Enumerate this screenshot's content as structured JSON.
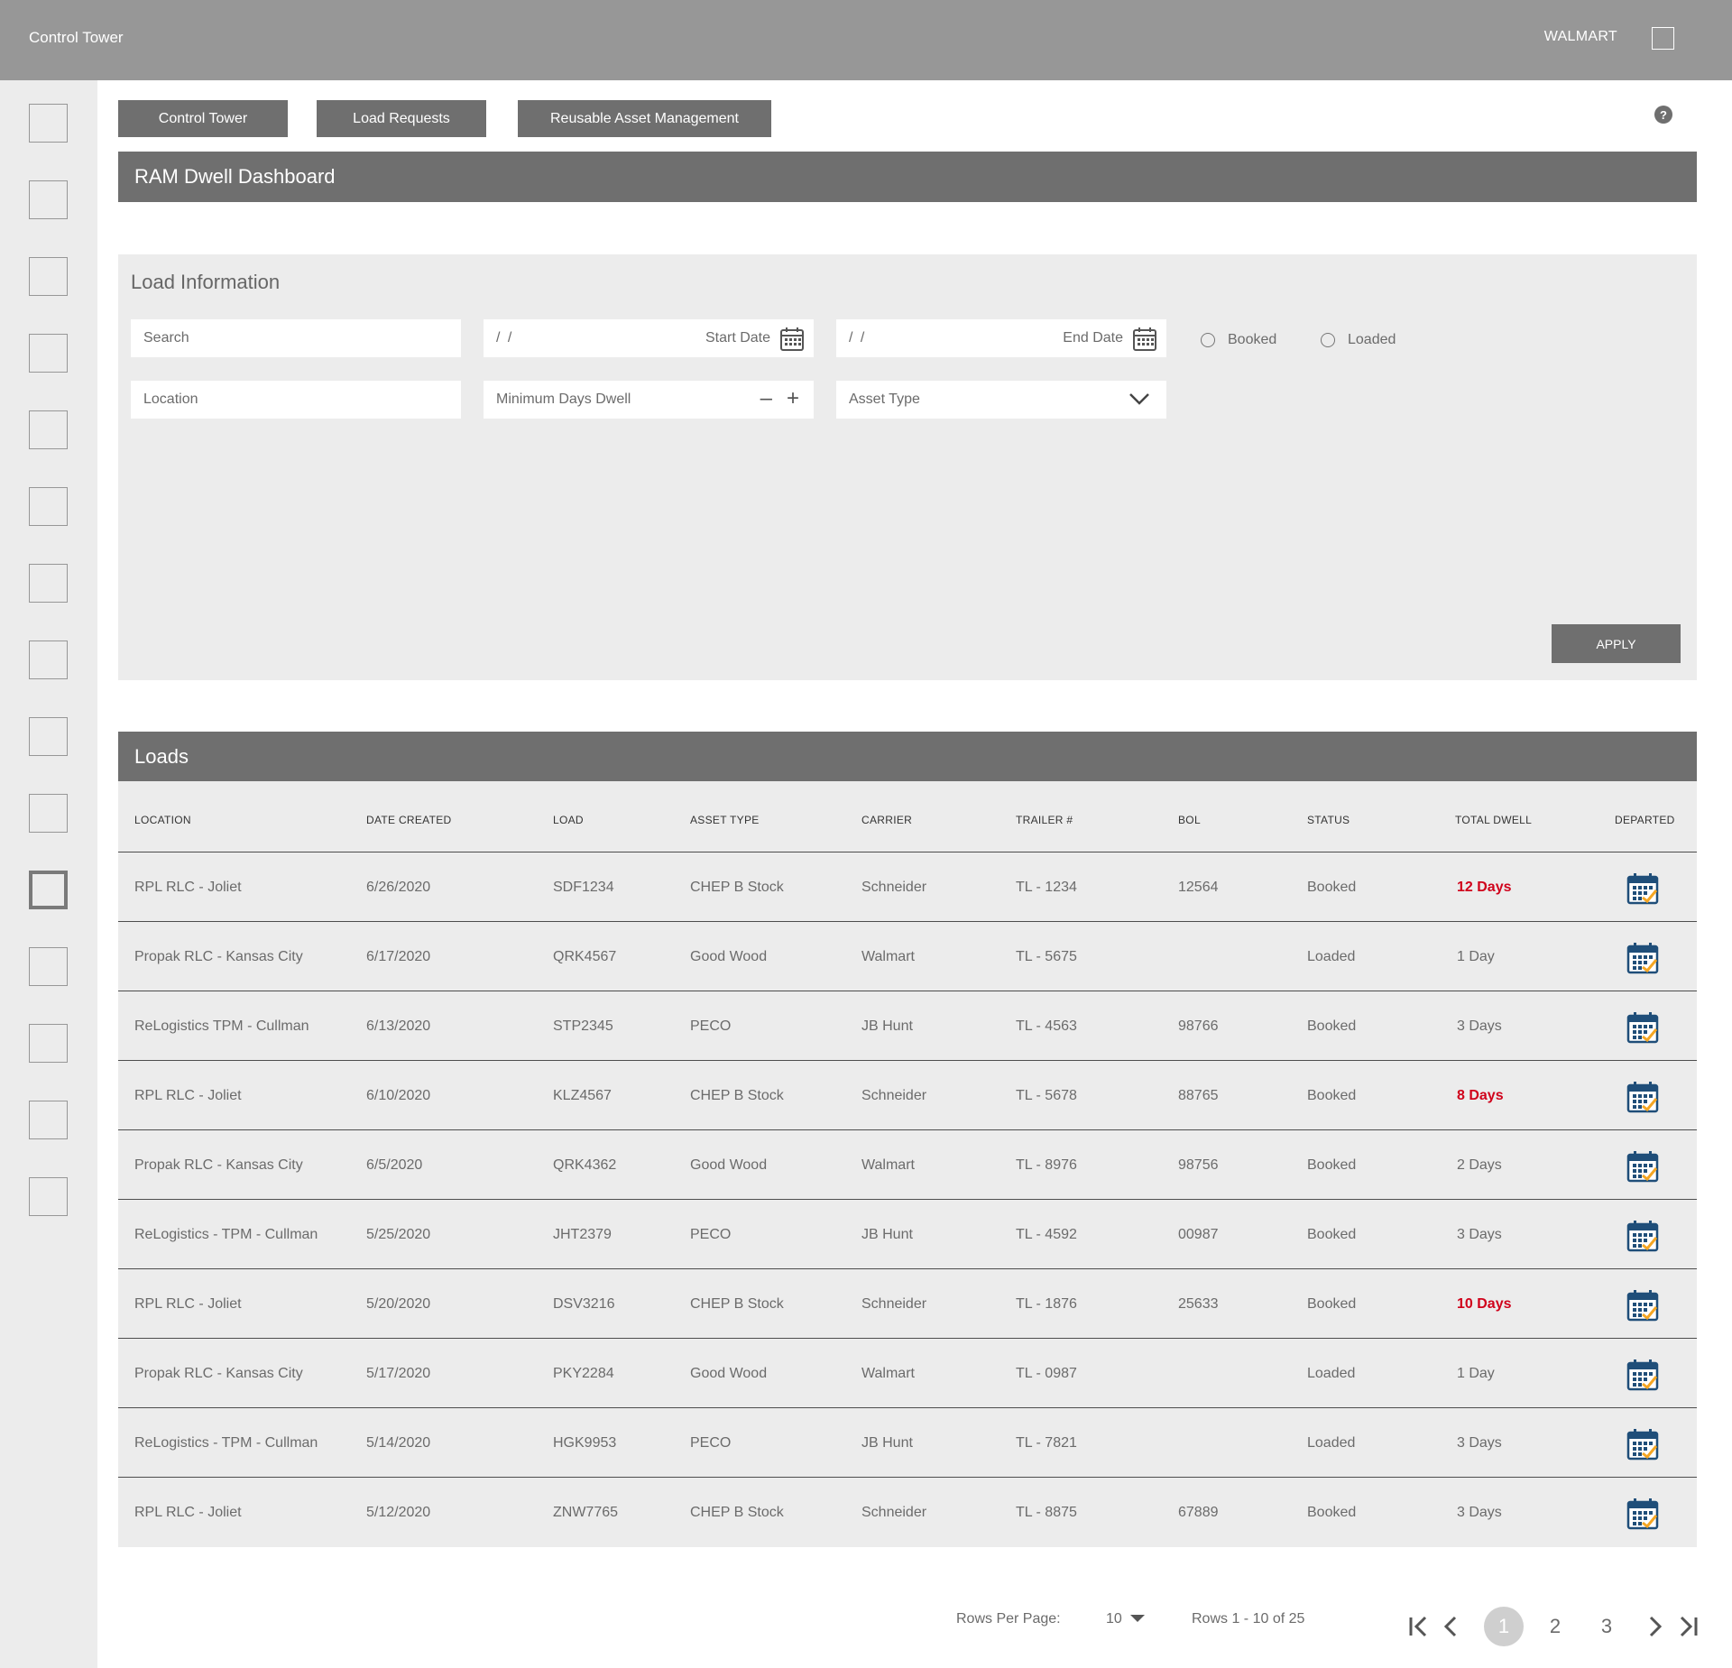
{
  "topbar": {
    "app_title": "Control Tower",
    "org_name": "WALMART"
  },
  "tabs": [
    {
      "label": "Control Tower"
    },
    {
      "label": "Load Requests"
    },
    {
      "label": "Reusable Asset Management"
    }
  ],
  "help_icon": "?",
  "dashboard_title": "RAM Dwell Dashboard",
  "filters": {
    "title": "Load Information",
    "search_placeholder": "Search",
    "date_slashes": "/    /",
    "start_date_label": "Start Date",
    "end_date_label": "End Date",
    "booked_label": "Booked",
    "loaded_label": "Loaded",
    "location_placeholder": "Location",
    "min_days_label": "Minimum Days Dwell",
    "minus": "–",
    "plus": "+",
    "asset_type_label": "Asset Type",
    "apply_label": "APPLY"
  },
  "loads": {
    "title": "Loads",
    "columns": [
      "LOCATION",
      "DATE CREATED",
      "LOAD",
      "ASSET TYPE",
      "CARRIER",
      "TRAILER #",
      "BOL",
      "STATUS",
      "TOTAL DWELL",
      "DEPARTED"
    ],
    "rows": [
      {
        "location": "RPL RLC - Joliet",
        "date": "6/26/2020",
        "load": "SDF1234",
        "asset": "CHEP B Stock",
        "carrier": "Schneider",
        "trailer": "TL - 1234",
        "bol": "12564",
        "status": "Booked",
        "dwell": "12 Days",
        "alert": true
      },
      {
        "location": "Propak RLC - Kansas City",
        "date": "6/17/2020",
        "load": "QRK4567",
        "asset": "Good Wood",
        "carrier": "Walmart",
        "trailer": "TL - 5675",
        "bol": "",
        "status": "Loaded",
        "dwell": "1 Day",
        "alert": false
      },
      {
        "location": "ReLogistics TPM - Cullman",
        "date": "6/13/2020",
        "load": "STP2345",
        "asset": "PECO",
        "carrier": "JB Hunt",
        "trailer": "TL - 4563",
        "bol": "98766",
        "status": "Booked",
        "dwell": "3 Days",
        "alert": false
      },
      {
        "location": "RPL RLC - Joliet",
        "date": "6/10/2020",
        "load": "KLZ4567",
        "asset": "CHEP B Stock",
        "carrier": "Schneider",
        "trailer": "TL - 5678",
        "bol": "88765",
        "status": "Booked",
        "dwell": "8 Days",
        "alert": true
      },
      {
        "location": "Propak RLC - Kansas City",
        "date": "6/5/2020",
        "load": "QRK4362",
        "asset": "Good Wood",
        "carrier": "Walmart",
        "trailer": "TL - 8976",
        "bol": "98756",
        "status": "Booked",
        "dwell": "2 Days",
        "alert": false
      },
      {
        "location": "ReLogistics - TPM - Cullman",
        "date": "5/25/2020",
        "load": "JHT2379",
        "asset": "PECO",
        "carrier": "JB Hunt",
        "trailer": "TL - 4592",
        "bol": "00987",
        "status": "Booked",
        "dwell": "3 Days",
        "alert": false
      },
      {
        "location": "RPL RLC - Joliet",
        "date": "5/20/2020",
        "load": "DSV3216",
        "asset": "CHEP B Stock",
        "carrier": "Schneider",
        "trailer": "TL - 1876",
        "bol": "25633",
        "status": "Booked",
        "dwell": "10 Days",
        "alert": true
      },
      {
        "location": "Propak RLC - Kansas City",
        "date": "5/17/2020",
        "load": "PKY2284",
        "asset": "Good Wood",
        "carrier": "Walmart",
        "trailer": "TL - 0987",
        "bol": "",
        "status": "Loaded",
        "dwell": "1 Day",
        "alert": false
      },
      {
        "location": "ReLogistics - TPM - Cullman",
        "date": "5/14/2020",
        "load": "HGK9953",
        "asset": "PECO",
        "carrier": "JB Hunt",
        "trailer": "TL - 7821",
        "bol": "",
        "status": "Loaded",
        "dwell": "3 Days",
        "alert": false
      },
      {
        "location": "RPL RLC - Joliet",
        "date": "5/12/2020",
        "load": "ZNW7765",
        "asset": "CHEP B Stock",
        "carrier": "Schneider",
        "trailer": "TL - 8875",
        "bol": "67889",
        "status": "Booked",
        "dwell": "3 Days",
        "alert": false
      }
    ]
  },
  "pagination": {
    "rows_per_page_label": "Rows Per Page:",
    "rows_per_page_value": "10",
    "rows_summary": "Rows 1 - 10 of 25",
    "pages": [
      "1",
      "2",
      "3"
    ],
    "current_page": "1"
  },
  "colors": {
    "alert_red": "#d0021b",
    "header_gray": "#6f6f6f",
    "calendar_blue": "#1f4e79",
    "calendar_orange": "#f5a623"
  },
  "icons": [
    "calendar-icon",
    "chevron-down-icon",
    "radio-icon",
    "first-page-icon",
    "prev-page-icon",
    "next-page-icon",
    "last-page-icon",
    "help-icon"
  ]
}
